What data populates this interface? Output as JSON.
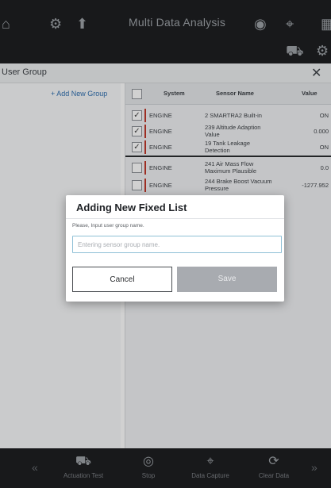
{
  "header": {
    "title": "Multi Data Analysis",
    "icons": [
      "home-icon",
      "vehicle-settings-icon",
      "vehicle-upload-icon",
      "record-icon",
      "capture-icon",
      "grid-icon"
    ]
  },
  "panel": {
    "title": "User Group",
    "add_group_label": "+ Add New Group"
  },
  "table": {
    "columns": [
      "System",
      "Sensor Name",
      "Value"
    ],
    "rows": [
      {
        "checked": true,
        "system": "ENGINE",
        "name": "2 SMARTRA2 Built-in",
        "value": "ON"
      },
      {
        "checked": true,
        "system": "ENGINE",
        "name": "239 Altitude Adaption Value",
        "value": "0.000"
      },
      {
        "checked": true,
        "system": "ENGINE",
        "name": "19 Tank Leakage Detection",
        "value": "ON"
      },
      {
        "checked": false,
        "system": "ENGINE",
        "name": "241 Air Mass Flow Maximum Plausible",
        "value": "0.0"
      },
      {
        "checked": false,
        "system": "ENGINE",
        "name": "244 Brake Boost Vacuum Pressure",
        "value": "-1277.952"
      }
    ]
  },
  "dialog": {
    "title": "Adding New Fixed List",
    "prompt": "Please, Input user group name.",
    "placeholder": "Entering sensor group name.",
    "cancel_label": "Cancel",
    "save_label": "Save"
  },
  "bottom_bar": {
    "items": [
      {
        "label": "Actuation Test",
        "icon": "actuation-icon"
      },
      {
        "label": "Stop",
        "icon": "stop-icon"
      },
      {
        "label": "Data Capture",
        "icon": "capture-icon"
      },
      {
        "label": "Clear Data",
        "icon": "refresh-icon"
      }
    ]
  }
}
